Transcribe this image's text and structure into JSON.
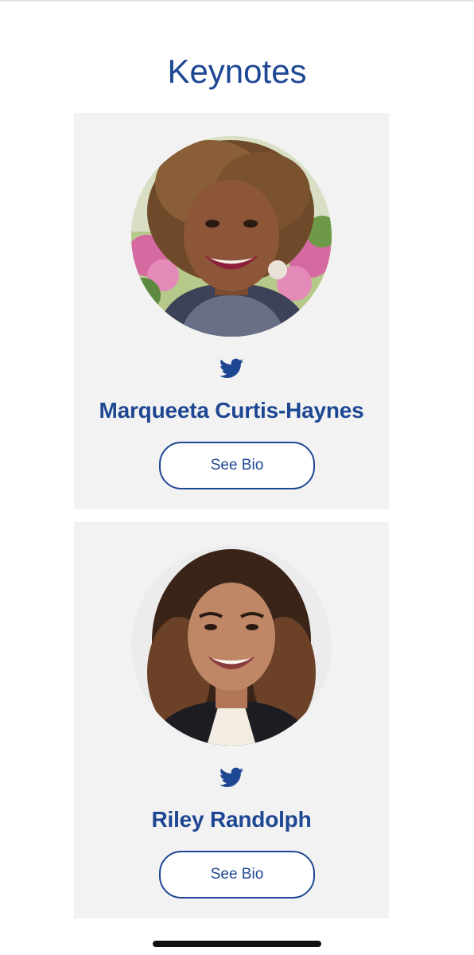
{
  "page": {
    "title": "Keynotes"
  },
  "speakers": [
    {
      "name": "Marqueeta Curtis-Haynes",
      "button_label": "See Bio",
      "social_icon": "twitter-icon"
    },
    {
      "name": "Riley Randolph",
      "button_label": "See Bio",
      "social_icon": "twitter-icon"
    }
  ],
  "colors": {
    "accent": "#1e4793",
    "card_background": "#f2f2f2",
    "twitter": "#1e4793"
  }
}
